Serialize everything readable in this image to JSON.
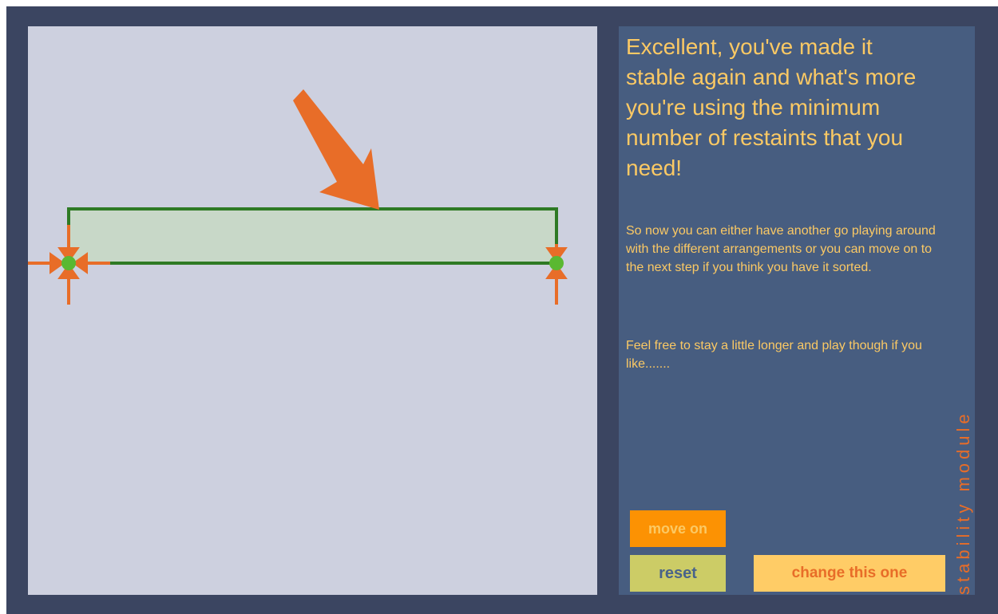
{
  "message": {
    "headline": "Excellent, you've made it stable again and what's more you're using the minimum number of restaints that you need!",
    "paragraph_1": "So now you can either have another go playing around with the different arrangements or you can move on to the next step if you think you have it sorted.",
    "paragraph_2": "Feel free to stay a little longer and play though if you like......."
  },
  "side_label": "stability module",
  "buttons": {
    "move_on": "move on",
    "reset": "reset",
    "change": "change this one"
  },
  "colors": {
    "outer_background": "#3b4561",
    "canvas_background": "#cdd0df",
    "panel_background": "#475d80",
    "text_accent": "#fbc964",
    "load_arrow": "#e86d28",
    "beam_outline": "#2e7a24",
    "beam_fill": "#c8d8c8",
    "support_node": "#5ab831"
  },
  "icons": [
    "load-arrow-icon",
    "restraint-arrow-icon",
    "support-node-icon"
  ]
}
